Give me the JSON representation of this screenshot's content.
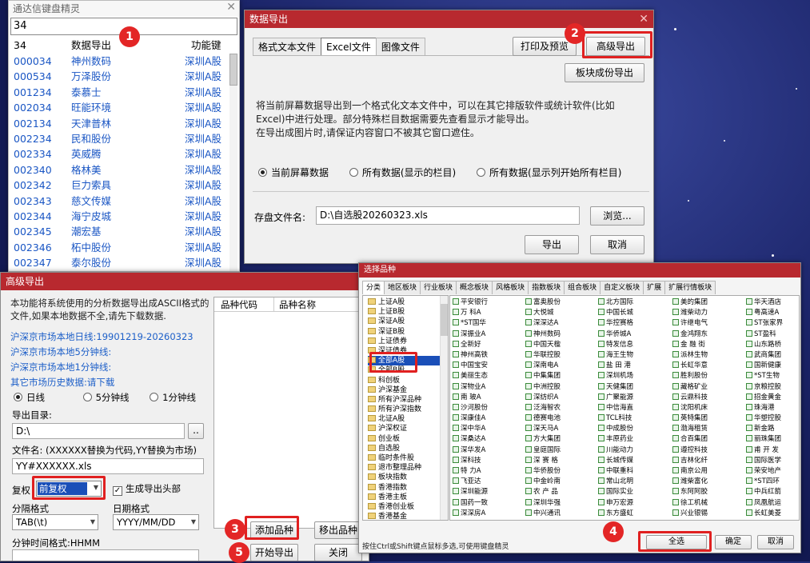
{
  "kb": {
    "title": "通达信键盘精灵",
    "input": "34",
    "header": {
      "code": "34",
      "name": "数据导出",
      "type": "功能键"
    },
    "rows": [
      {
        "code": "000034",
        "name": "神州数码",
        "market": "深圳A股"
      },
      {
        "code": "000534",
        "name": "万泽股份",
        "market": "深圳A股"
      },
      {
        "code": "001234",
        "name": "泰慕士",
        "market": "深圳A股"
      },
      {
        "code": "002034",
        "name": "旺能环境",
        "market": "深圳A股"
      },
      {
        "code": "002134",
        "name": "天津普林",
        "market": "深圳A股"
      },
      {
        "code": "002234",
        "name": "民和股份",
        "market": "深圳A股"
      },
      {
        "code": "002334",
        "name": "英威腾",
        "market": "深圳A股"
      },
      {
        "code": "002340",
        "name": "格林美",
        "market": "深圳A股"
      },
      {
        "code": "002342",
        "name": "巨力索具",
        "market": "深圳A股"
      },
      {
        "code": "002343",
        "name": "慈文传媒",
        "market": "深圳A股"
      },
      {
        "code": "002344",
        "name": "海宁皮城",
        "market": "深圳A股"
      },
      {
        "code": "002345",
        "name": "潮宏基",
        "market": "深圳A股"
      },
      {
        "code": "002346",
        "name": "柘中股份",
        "market": "深圳A股"
      },
      {
        "code": "002347",
        "name": "泰尔股份",
        "market": "深圳A股"
      }
    ]
  },
  "export": {
    "title": "数据导出",
    "tabs": [
      "格式文本文件",
      "Excel文件",
      "图像文件"
    ],
    "print_preview": "打印及预览",
    "advanced_export": "高级导出",
    "block_export": "板块成份导出",
    "desc1": "将当前屏幕数据导出到一个格式化文本文件中，可以在其它排版软件或统计软件(比如",
    "desc2": "Excel)中进行处理。部分特殊栏目数据需要先查看显示才能导出。",
    "desc3": "在导出成图片时,请保证内容窗口不被其它窗口遮住。",
    "radio1": "当前屏幕数据",
    "radio2": "所有数据(显示的栏目)",
    "radio3": "所有数据(显示列开始所有栏目)",
    "save_label": "存盘文件名:",
    "save_path": "D:\\自选股20260323.xls",
    "browse": "浏览...",
    "ok": "导出",
    "cancel": "取消"
  },
  "adv": {
    "title": "高级导出",
    "desc": "本功能将系统使用的分析数据导出成ASCII格式的文件,如果本地数据不全,请先下载数据.",
    "info1": "沪深京市场本地日线:19901219-20260323",
    "info2": "沪深京市场本地5分钟线:",
    "info3": "沪深京市场本地1分钟线:",
    "info4": "其它市场历史数据:请下载",
    "r_day": "日线",
    "r_5m": "5分钟线",
    "r_1m": "1分钟线",
    "dir_label": "导出目录:",
    "dir_value": "D:\\",
    "dir_btn": "..",
    "file_label": "文件名:  (XXXXXX替换为代码,YY替换为市场)",
    "file_value": "YY#XXXXXX.xls",
    "fq_label": "复权",
    "fq_value": "前复权",
    "gen_header": "生成导出头部",
    "sep_label": "分隔格式",
    "sep_value": "TAB(\\t)",
    "date_label": "日期格式",
    "date_value": "YYYY/MM/DD",
    "time_label": "分钟时间格式:HHMM",
    "col_code": "品种代码",
    "col_name": "品种名称",
    "add": "添加品种",
    "remove": "移出品种",
    "start": "开始导出",
    "close": "关闭"
  },
  "choose": {
    "title": "选择品种",
    "tabs": [
      "分类",
      "地区板块",
      "行业板块",
      "概念板块",
      "风格板块",
      "指数板块",
      "组合板块",
      "自定义板块",
      "扩展",
      "扩展行情板块"
    ],
    "tree": [
      "上证A股",
      "上证B股",
      "深证A股",
      "深证B股",
      "上证债券",
      "深证债券",
      "全部A股",
      "全部B股",
      "科创板",
      "沪深基金",
      "所有沪深品种",
      "所有沪深指数",
      "北证A股",
      "沪深权证",
      "创业板",
      "自选股",
      "临时条件股",
      "退市整理品种",
      "板块指数",
      "香港指数",
      "香港主板",
      "香港创业板",
      "香港基金"
    ],
    "cols": [
      [
        "平安银行",
        "万 科A",
        "*ST国华",
        "深振业A",
        "全新好",
        "神州高铁",
        "中国宝安",
        "美丽生态",
        "深物业A",
        "南 玻A",
        "沙河股份",
        "深康佳A",
        "深中华A",
        "深桑达A",
        "深华发A",
        "深科技",
        "特 力A",
        "飞亚达",
        "深圳能源",
        "国药一致",
        "深深房A"
      ],
      [
        "富奥股份",
        "大悦城",
        "深深达A",
        "神州数码",
        "中国天楹",
        "华联控股",
        "深南电A",
        "中集集团",
        "中洲控股",
        "深纺织A",
        "泛海智农",
        "德赛电池",
        "深天马A",
        "方大集团",
        "皇庭国际",
        "深 赛 格",
        "华侨股份",
        "中金岭南",
        "农 产 品",
        "深圳华强",
        "中兴通讯"
      ],
      [
        "北方国际",
        "中国长城",
        "华控赛格",
        "华侨城A",
        "特发信息",
        "海王生物",
        "盐 田 港",
        "深圳机场",
        "天健集团",
        "广聚能源",
        "中信海直",
        "TCL科技",
        "中成股份",
        "丰原药业",
        "川能动力",
        "长城传媒",
        "中联重科",
        "常山北明",
        "国际实业",
        "申万宏源",
        "东方盛虹"
      ],
      [
        "美的集团",
        "潍柴动力",
        "许继电气",
        "金鸿翔东",
        "金 融 街",
        "派林生物",
        "长虹华意",
        "胜利股份",
        "藏格矿业",
        "云鼎科技",
        "沈阳机床",
        "英特集团",
        "渤海租赁",
        "合百集团",
        "遵控科技",
        "吉林化纤",
        "南京公用",
        "潍柴富化",
        "东阿阿胶",
        "徐工机械",
        "兴业银锡"
      ],
      [
        "华天酒店",
        "粤高速A",
        "ST张家界",
        "ST盈科",
        "山东路桥",
        "武商集团",
        "国新健康",
        "*ST生物",
        "京粮控股",
        "招金黄金",
        "珠海港",
        "华塑控股",
        "新金路",
        "丽珠集团",
        "甫 开 发",
        "国际医学",
        "荣安地产",
        "*ST四环",
        "中兵红箭",
        "凤凰航运",
        "长虹美菱"
      ]
    ],
    "status": "按住Ctrl或Shift键点鼠标多选,可使用键盘精灵",
    "select_all": "全选",
    "ok": "确定",
    "cancel": "取消"
  },
  "markers": [
    "1",
    "2",
    "3",
    "4",
    "5"
  ],
  "colors": {
    "title_red": "#b8292f",
    "marker_red": "#e32626",
    "link_blue": "#1d5fc8"
  }
}
